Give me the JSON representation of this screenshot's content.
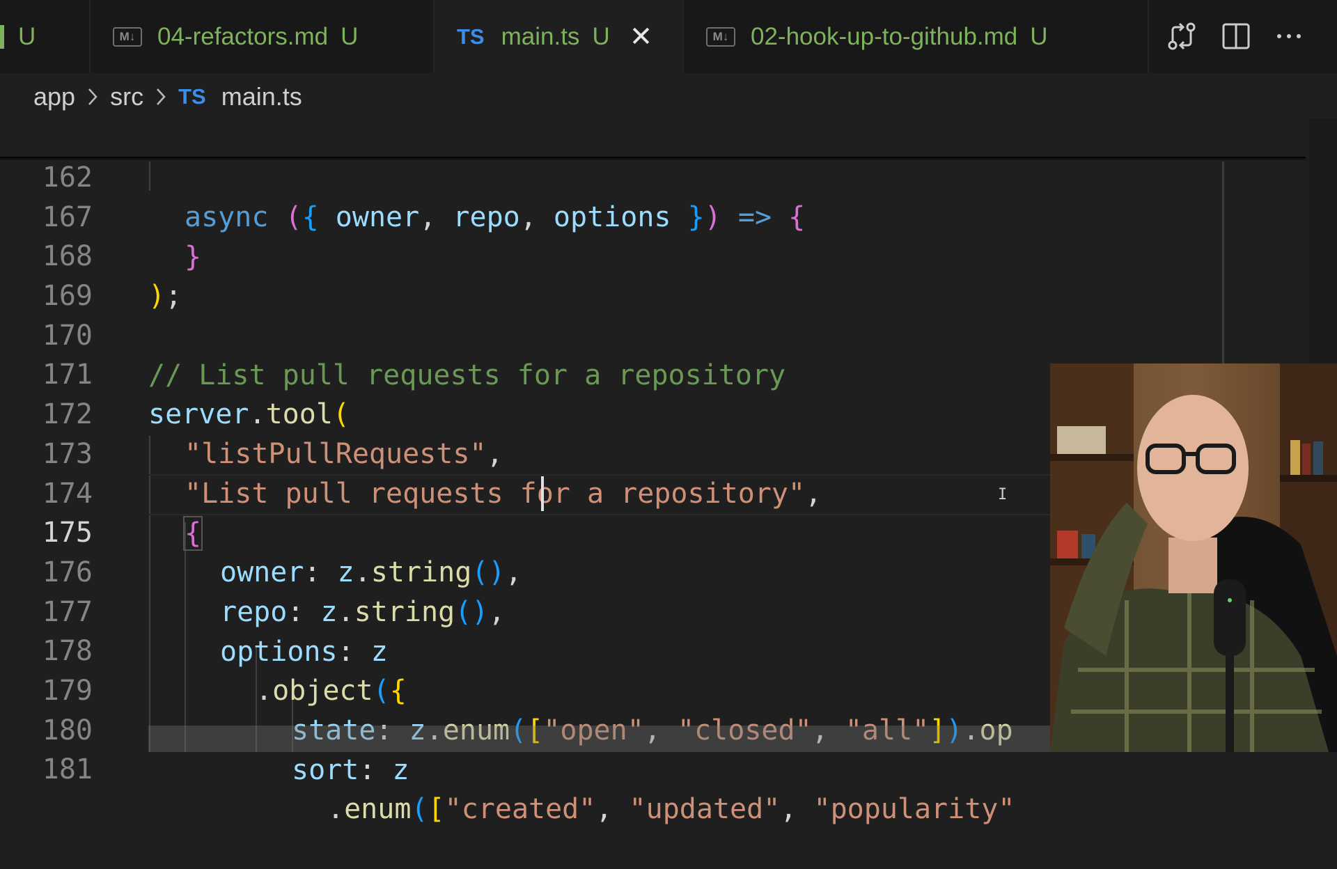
{
  "tabs": [
    {
      "label": "",
      "status": "U",
      "type": "partial"
    },
    {
      "label": "04-refactors.md",
      "status": "U",
      "type": "markdown",
      "icon": "M↓"
    },
    {
      "label": "main.ts",
      "status": "U",
      "type": "typescript",
      "icon": "TS",
      "active": true
    },
    {
      "label": "02-hook-up-to-github.md",
      "status": "U",
      "type": "markdown",
      "icon": "M↓"
    }
  ],
  "toolbar": {
    "compare_icon": "git-compare-icon",
    "split_icon": "split-editor-icon",
    "more_icon": "more-actions-icon"
  },
  "breadcrumb": {
    "parts": [
      "app",
      "src"
    ],
    "file_icon": "TS",
    "file": "main.ts"
  },
  "editor": {
    "current_line": "175",
    "lines": [
      {
        "n": "162"
      },
      {
        "n": "167"
      },
      {
        "n": "168"
      },
      {
        "n": "169"
      },
      {
        "n": "170"
      },
      {
        "n": "171"
      },
      {
        "n": "172"
      },
      {
        "n": "173"
      },
      {
        "n": "174"
      },
      {
        "n": "175"
      },
      {
        "n": "176"
      },
      {
        "n": "177"
      },
      {
        "n": "178"
      },
      {
        "n": "179"
      },
      {
        "n": "180"
      },
      {
        "n": "181"
      }
    ],
    "code": {
      "l162": [
        "async",
        "(",
        "{",
        "owner",
        ",",
        "repo",
        ",",
        "options",
        "}",
        ")",
        "=>",
        "{"
      ],
      "l167": [
        "}"
      ],
      "l168": [
        ")",
        ";"
      ],
      "l170": "// List pull requests for a repository",
      "l171": [
        "server",
        ".",
        "tool",
        "("
      ],
      "l172": [
        "\"listPullRequests\"",
        ","
      ],
      "l173": [
        "\"List pull requests for a repository\"",
        ","
      ],
      "l174": [
        "{"
      ],
      "l175": [
        "owner",
        ":",
        "z",
        ".",
        "string",
        "(",
        ")",
        ","
      ],
      "l176": [
        "repo",
        ":",
        "z",
        ".",
        "string",
        "(",
        ")",
        ","
      ],
      "l177": [
        "options",
        ":",
        "z"
      ],
      "l178": [
        ".",
        "object",
        "(",
        "{"
      ],
      "l179": [
        "state",
        ":",
        "z",
        ".",
        "enum",
        "(",
        "[",
        "\"open\"",
        ",",
        "\"closed\"",
        ",",
        "\"all\"",
        "]",
        ")",
        ".",
        "op"
      ],
      "l180": [
        "sort",
        ":",
        "z"
      ],
      "l181": [
        ".",
        "enum",
        "(",
        "[",
        "\"created\"",
        ",",
        "\"updated\"",
        ",",
        "\"popularity\""
      ]
    }
  },
  "colors": {
    "background": "#1f1f1f",
    "tabbar": "#181818",
    "keyword": "#569cd6",
    "variable": "#9cdcfe",
    "function": "#dcdcaa",
    "string": "#ce9178",
    "comment": "#6a9955",
    "bracket_gold": "#ffd700",
    "bracket_pink": "#da70d6",
    "bracket_blue": "#179fff",
    "modified_file": "#7fb25c"
  },
  "overlay": {
    "webcam": "presenter-webcam"
  }
}
